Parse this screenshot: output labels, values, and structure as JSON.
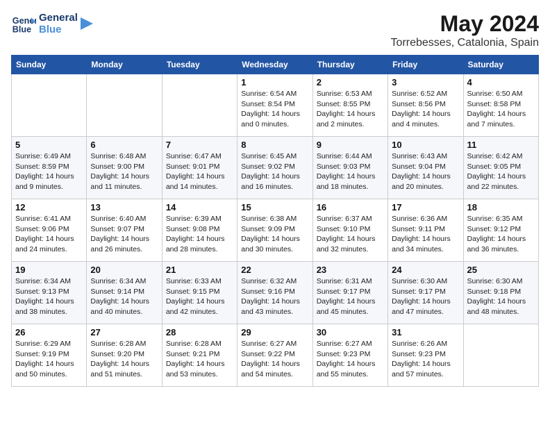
{
  "header": {
    "logo_line1": "General",
    "logo_line2": "Blue",
    "month": "May 2024",
    "location": "Torrebesses, Catalonia, Spain"
  },
  "weekdays": [
    "Sunday",
    "Monday",
    "Tuesday",
    "Wednesday",
    "Thursday",
    "Friday",
    "Saturday"
  ],
  "weeks": [
    [
      {
        "day": "",
        "empty": true
      },
      {
        "day": "",
        "empty": true
      },
      {
        "day": "",
        "empty": true
      },
      {
        "day": "1",
        "sunrise": "6:54 AM",
        "sunset": "8:54 PM",
        "daylight": "14 hours and 0 minutes."
      },
      {
        "day": "2",
        "sunrise": "6:53 AM",
        "sunset": "8:55 PM",
        "daylight": "14 hours and 2 minutes."
      },
      {
        "day": "3",
        "sunrise": "6:52 AM",
        "sunset": "8:56 PM",
        "daylight": "14 hours and 4 minutes."
      },
      {
        "day": "4",
        "sunrise": "6:50 AM",
        "sunset": "8:58 PM",
        "daylight": "14 hours and 7 minutes."
      }
    ],
    [
      {
        "day": "5",
        "sunrise": "6:49 AM",
        "sunset": "8:59 PM",
        "daylight": "14 hours and 9 minutes."
      },
      {
        "day": "6",
        "sunrise": "6:48 AM",
        "sunset": "9:00 PM",
        "daylight": "14 hours and 11 minutes."
      },
      {
        "day": "7",
        "sunrise": "6:47 AM",
        "sunset": "9:01 PM",
        "daylight": "14 hours and 14 minutes."
      },
      {
        "day": "8",
        "sunrise": "6:45 AM",
        "sunset": "9:02 PM",
        "daylight": "14 hours and 16 minutes."
      },
      {
        "day": "9",
        "sunrise": "6:44 AM",
        "sunset": "9:03 PM",
        "daylight": "14 hours and 18 minutes."
      },
      {
        "day": "10",
        "sunrise": "6:43 AM",
        "sunset": "9:04 PM",
        "daylight": "14 hours and 20 minutes."
      },
      {
        "day": "11",
        "sunrise": "6:42 AM",
        "sunset": "9:05 PM",
        "daylight": "14 hours and 22 minutes."
      }
    ],
    [
      {
        "day": "12",
        "sunrise": "6:41 AM",
        "sunset": "9:06 PM",
        "daylight": "14 hours and 24 minutes."
      },
      {
        "day": "13",
        "sunrise": "6:40 AM",
        "sunset": "9:07 PM",
        "daylight": "14 hours and 26 minutes."
      },
      {
        "day": "14",
        "sunrise": "6:39 AM",
        "sunset": "9:08 PM",
        "daylight": "14 hours and 28 minutes."
      },
      {
        "day": "15",
        "sunrise": "6:38 AM",
        "sunset": "9:09 PM",
        "daylight": "14 hours and 30 minutes."
      },
      {
        "day": "16",
        "sunrise": "6:37 AM",
        "sunset": "9:10 PM",
        "daylight": "14 hours and 32 minutes."
      },
      {
        "day": "17",
        "sunrise": "6:36 AM",
        "sunset": "9:11 PM",
        "daylight": "14 hours and 34 minutes."
      },
      {
        "day": "18",
        "sunrise": "6:35 AM",
        "sunset": "9:12 PM",
        "daylight": "14 hours and 36 minutes."
      }
    ],
    [
      {
        "day": "19",
        "sunrise": "6:34 AM",
        "sunset": "9:13 PM",
        "daylight": "14 hours and 38 minutes."
      },
      {
        "day": "20",
        "sunrise": "6:34 AM",
        "sunset": "9:14 PM",
        "daylight": "14 hours and 40 minutes."
      },
      {
        "day": "21",
        "sunrise": "6:33 AM",
        "sunset": "9:15 PM",
        "daylight": "14 hours and 42 minutes."
      },
      {
        "day": "22",
        "sunrise": "6:32 AM",
        "sunset": "9:16 PM",
        "daylight": "14 hours and 43 minutes."
      },
      {
        "day": "23",
        "sunrise": "6:31 AM",
        "sunset": "9:17 PM",
        "daylight": "14 hours and 45 minutes."
      },
      {
        "day": "24",
        "sunrise": "6:30 AM",
        "sunset": "9:17 PM",
        "daylight": "14 hours and 47 minutes."
      },
      {
        "day": "25",
        "sunrise": "6:30 AM",
        "sunset": "9:18 PM",
        "daylight": "14 hours and 48 minutes."
      }
    ],
    [
      {
        "day": "26",
        "sunrise": "6:29 AM",
        "sunset": "9:19 PM",
        "daylight": "14 hours and 50 minutes."
      },
      {
        "day": "27",
        "sunrise": "6:28 AM",
        "sunset": "9:20 PM",
        "daylight": "14 hours and 51 minutes."
      },
      {
        "day": "28",
        "sunrise": "6:28 AM",
        "sunset": "9:21 PM",
        "daylight": "14 hours and 53 minutes."
      },
      {
        "day": "29",
        "sunrise": "6:27 AM",
        "sunset": "9:22 PM",
        "daylight": "14 hours and 54 minutes."
      },
      {
        "day": "30",
        "sunrise": "6:27 AM",
        "sunset": "9:23 PM",
        "daylight": "14 hours and 55 minutes."
      },
      {
        "day": "31",
        "sunrise": "6:26 AM",
        "sunset": "9:23 PM",
        "daylight": "14 hours and 57 minutes."
      },
      {
        "day": "",
        "empty": true
      }
    ]
  ]
}
